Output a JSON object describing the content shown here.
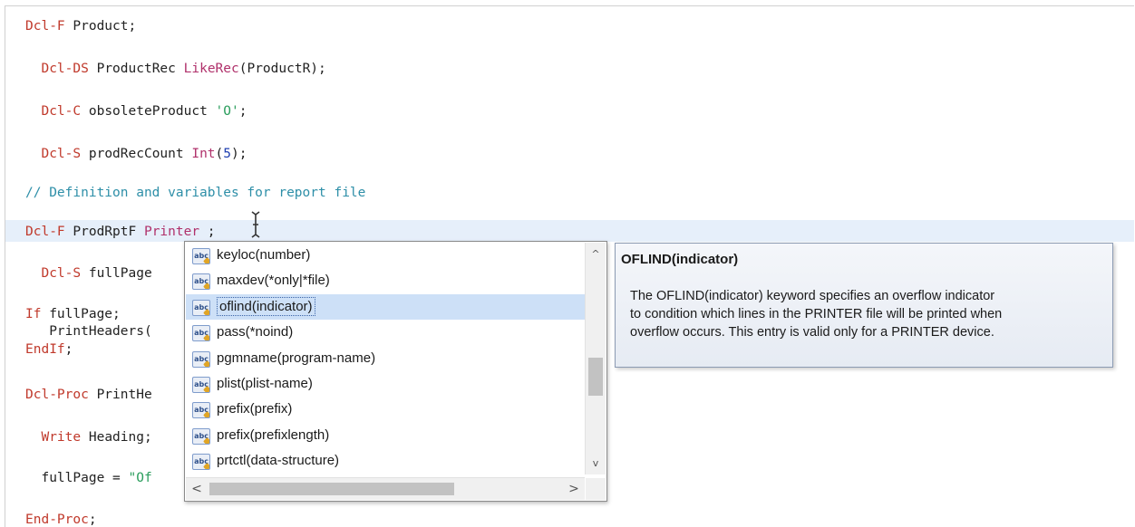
{
  "editor": {
    "code": {
      "dcl_f_1": {
        "kw": "Dcl-F",
        "rest": " Product;"
      },
      "dcl_ds": {
        "kw": "Dcl-DS",
        "name": " ProductRec ",
        "bi": "LikeRec",
        "rest": "(ProductR);"
      },
      "dcl_c": {
        "kw": "Dcl-C",
        "name": " obsoleteProduct ",
        "str": "'O'",
        "rest": ";"
      },
      "dcl_s_1": {
        "kw": "Dcl-S",
        "name": " prodRecCount ",
        "bi": "Int",
        "open": "(",
        "num": "5",
        "close": ");"
      },
      "comment": "// Definition and variables for report file",
      "dcl_f_2": {
        "kw": "Dcl-F",
        "name": " ProdRptF ",
        "bi": "Printer",
        "rest": " ;"
      },
      "dcl_s_2": {
        "kw": "Dcl-S",
        "name": " fullPage"
      },
      "if_line": {
        "kw": "If",
        "rest": " fullPage;"
      },
      "print_headers": "   PrintHeaders(",
      "endif": {
        "kw": "EndIf",
        "rest": ";"
      },
      "dcl_proc": {
        "kw": "Dcl-Proc",
        "rest": " PrintHe"
      },
      "write": {
        "kw": "Write",
        "rest": " Heading;"
      },
      "fullpage_assign": {
        "name": "  fullPage = ",
        "str": "\"Of"
      },
      "end_proc": {
        "kw": "End-Proc",
        "rest": ";"
      }
    }
  },
  "completion": {
    "items": [
      {
        "label": "keyloc(number)",
        "icon": "keyword-icon"
      },
      {
        "label": "maxdev(*only|*file)",
        "icon": "keyword-icon"
      },
      {
        "label": "oflind(indicator)",
        "icon": "keyword-icon",
        "selected": true
      },
      {
        "label": "pass(*noind)",
        "icon": "keyword-icon"
      },
      {
        "label": "pgmname(program-name)",
        "icon": "keyword-icon"
      },
      {
        "label": "plist(plist-name)",
        "icon": "keyword-icon"
      },
      {
        "label": "prefix(prefix)",
        "icon": "keyword-icon"
      },
      {
        "label": "prefix(prefixlength)",
        "icon": "keyword-icon"
      },
      {
        "label": "prtctl(data-structure)",
        "icon": "keyword-icon"
      }
    ],
    "icon_text": "abc",
    "scroll_up": "^",
    "scroll_down": "v",
    "scroll_left": "<",
    "scroll_right": ">"
  },
  "tooltip": {
    "title": "OFLIND(indicator)",
    "body_lines": [
      "The OFLIND(indicator) keyword specifies an overflow indicator",
      "  to condition which lines in the PRINTER file will be printed when",
      "  overflow occurs. This entry is valid only for a PRINTER device."
    ]
  },
  "colors": {
    "keyword": "#c0392b",
    "builtin": "#b0316b",
    "number": "#1f3fb0",
    "string": "#2a9d5c",
    "comment": "#2e8fa8",
    "selection": "#cde0f7"
  }
}
